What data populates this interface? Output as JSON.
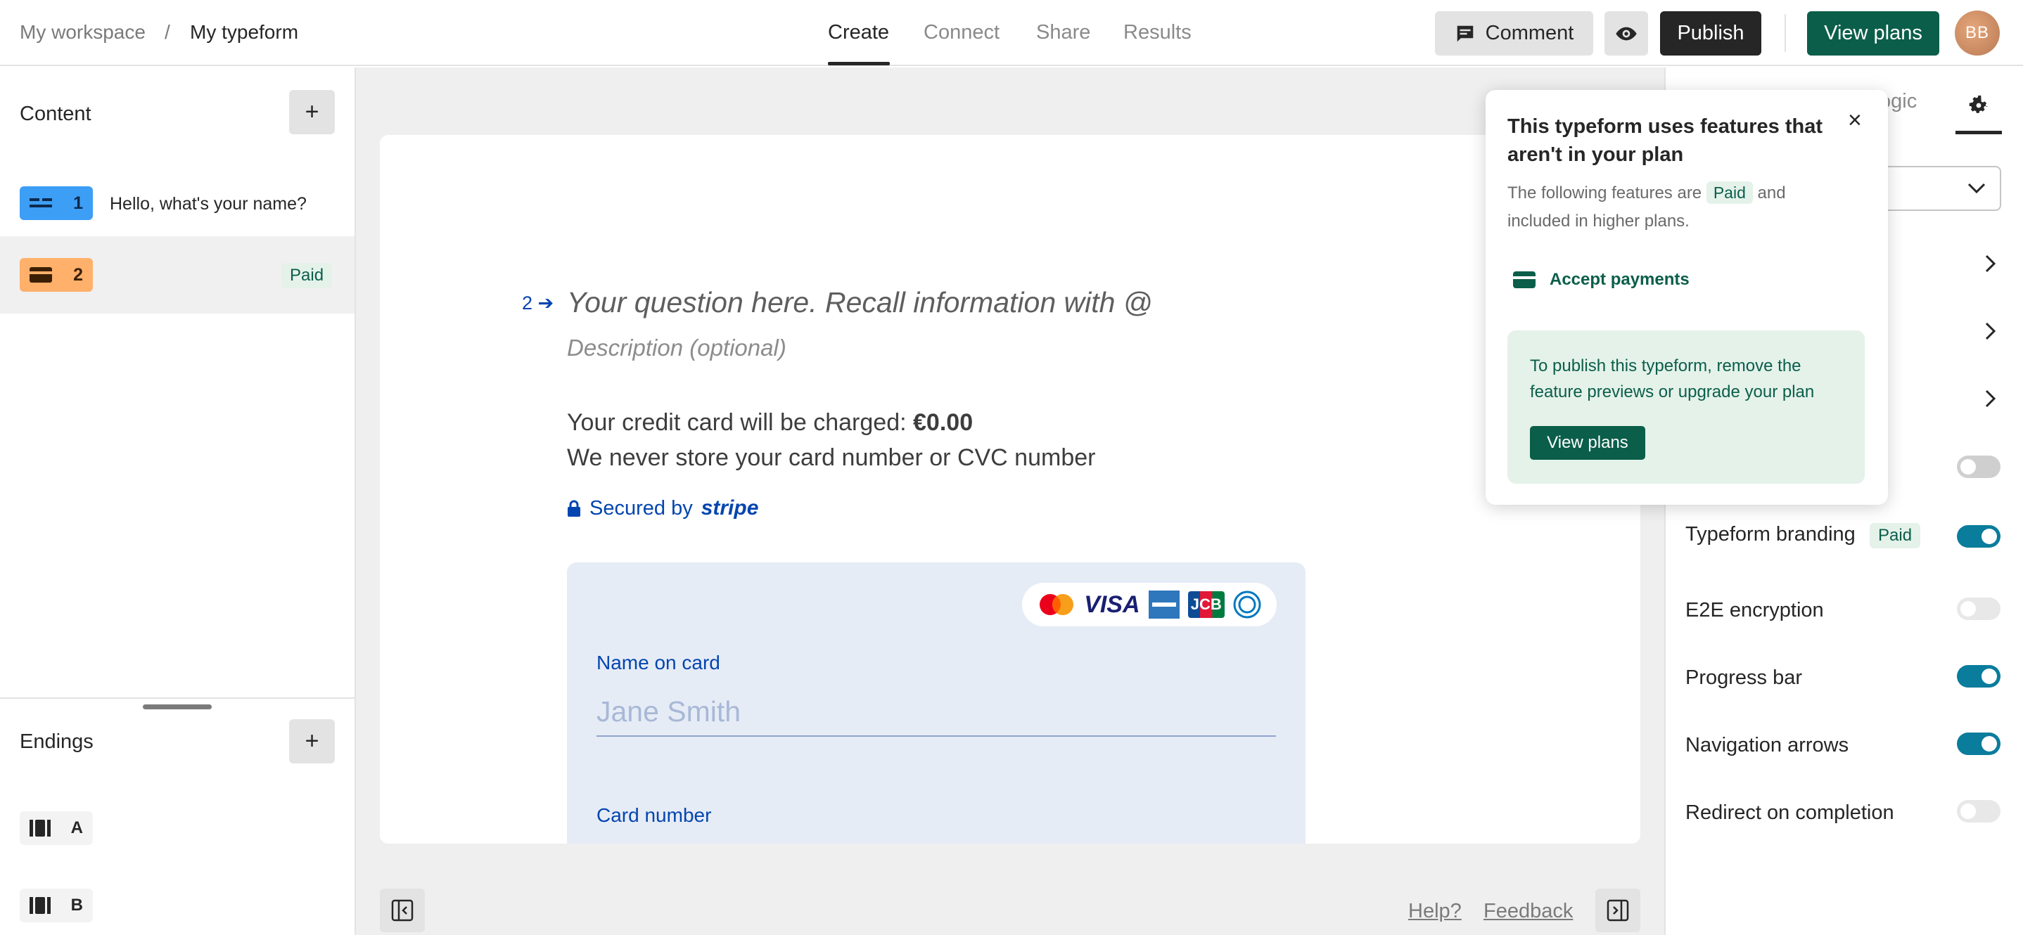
{
  "header": {
    "breadcrumb": {
      "workspace": "My workspace",
      "separator": "/",
      "form": "My typeform"
    },
    "tabs": [
      {
        "label": "Create",
        "active": true
      },
      {
        "label": "Connect",
        "active": false
      },
      {
        "label": "Share",
        "active": false
      },
      {
        "label": "Results",
        "active": false
      }
    ],
    "comment_label": "Comment",
    "publish_label": "Publish",
    "view_plans_label": "View plans",
    "avatar_initials": "BB"
  },
  "sidebar": {
    "content_title": "Content",
    "add_symbol": "+",
    "questions": [
      {
        "number": "1",
        "text": "Hello, what's your name?",
        "icon": "short-text-icon",
        "color": "#3D9EF5"
      },
      {
        "number": "2",
        "text": "",
        "badge": "Paid",
        "icon": "credit-card-icon",
        "color": "#FFB06B"
      }
    ],
    "endings_title": "Endings",
    "endings": [
      {
        "label": "A",
        "icon": "ending-icon"
      },
      {
        "label": "B",
        "icon": "ending-icon"
      }
    ]
  },
  "canvas": {
    "question_number": "2",
    "question_placeholder": "Your question here. Recall information with @",
    "description_placeholder": "Description (optional)",
    "charge_prefix": "Your credit card will be charged: ",
    "charge_amount": "€0.00",
    "store_note": "We never store your card number or CVC number",
    "secured_prefix": "Secured by",
    "secured_brand": "stripe",
    "card_brands": [
      "mastercard",
      "VISA",
      "amex",
      "JCB",
      "diners"
    ],
    "name_label": "Name on card",
    "name_placeholder": "Jane Smith",
    "card_number_label": "Card number",
    "help_label": "Help?",
    "feedback_label": "Feedback"
  },
  "right_panel": {
    "tab_partial": "ogic",
    "rows": [
      {
        "label": "Typeform branding",
        "badge": "Paid",
        "state": "on"
      },
      {
        "label": "E2E encryption",
        "state": "disabled"
      },
      {
        "label": "Progress bar",
        "state": "on"
      },
      {
        "label": "Navigation arrows",
        "state": "on"
      },
      {
        "label": "Redirect on completion",
        "state": "disabled"
      }
    ],
    "partial_row_text": "g",
    "accent_color": "#0A7C9C"
  },
  "popover": {
    "title": "This typeform uses features that aren't in your plan",
    "desc_prefix": "The following features are",
    "desc_badge": "Paid",
    "desc_suffix": "and included in higher plans.",
    "feature": "Accept payments",
    "notice": "To publish this typeform, remove the feature previews or upgrade your plan",
    "button_label": "View plans",
    "close_symbol": "×"
  },
  "colors": {
    "brand_green": "#0B5E4A",
    "paid_bg": "#E4F2EA",
    "link_blue": "#0445AF",
    "card_bg": "#E6ECF6"
  }
}
